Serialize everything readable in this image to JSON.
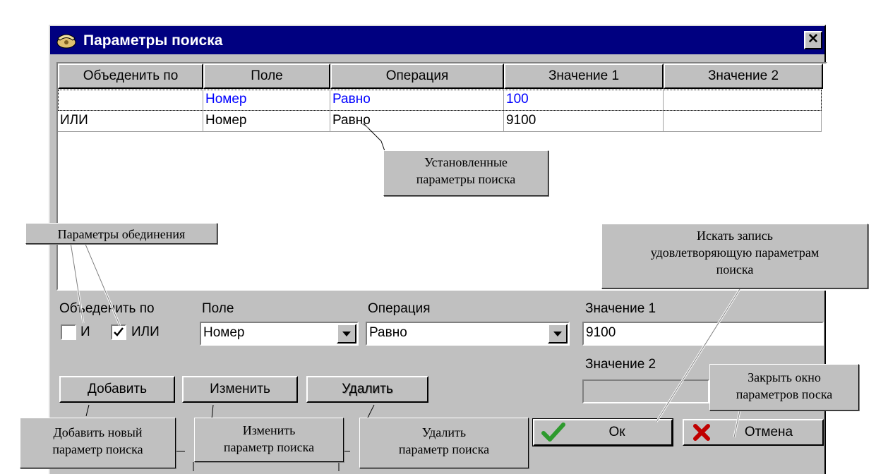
{
  "window": {
    "title": "Параметры поиска",
    "close_label": "✕"
  },
  "grid": {
    "columns": [
      "Объеденить по",
      "Поле",
      "Операция",
      "Значение 1",
      "Значение 2"
    ],
    "rows": [
      [
        "",
        "Номер",
        "Равно",
        "100",
        ""
      ],
      [
        "ИЛИ",
        "Номер",
        "Равно",
        "9100",
        ""
      ]
    ]
  },
  "form": {
    "combine_label": "Объеденить по",
    "and_label": "И",
    "or_label": "ИЛИ",
    "field_label": "Поле",
    "field_value": "Номер",
    "operation_label": "Операция",
    "operation_value": "Равно",
    "value1_label": "Значение 1",
    "value1_value": "9100",
    "value2_label": "Значение 2",
    "value2_value": ""
  },
  "buttons": {
    "add": "Добавить",
    "edit": "Изменить",
    "delete": "Удалить",
    "ok": "Ок",
    "cancel": "Отмена"
  },
  "callouts": {
    "installed_line1": "Установленные",
    "installed_line2": "параметры поиска",
    "combine": "Параметры обединения",
    "search_line1": "Искать запись",
    "search_line2": "удовлетворяющую параметрам",
    "search_line3": "поиска",
    "close_line1": "Закрыть окно",
    "close_line2": "параметров поска",
    "add_line1": "Добавить новый",
    "add_line2": "параметр поиска",
    "edit_line1": "Изменить",
    "edit_line2": "параметр поиска",
    "delete_line1": "Удалить",
    "delete_line2": "параметр поиска"
  },
  "colors": {
    "title_bar": "#000080",
    "selected_text": "#0000ff",
    "ok_check": "#2e9a2e",
    "cancel_x": "#c00000"
  },
  "icons": {
    "title": "phone-icon",
    "ok": "check-icon",
    "cancel": "x-icon"
  }
}
